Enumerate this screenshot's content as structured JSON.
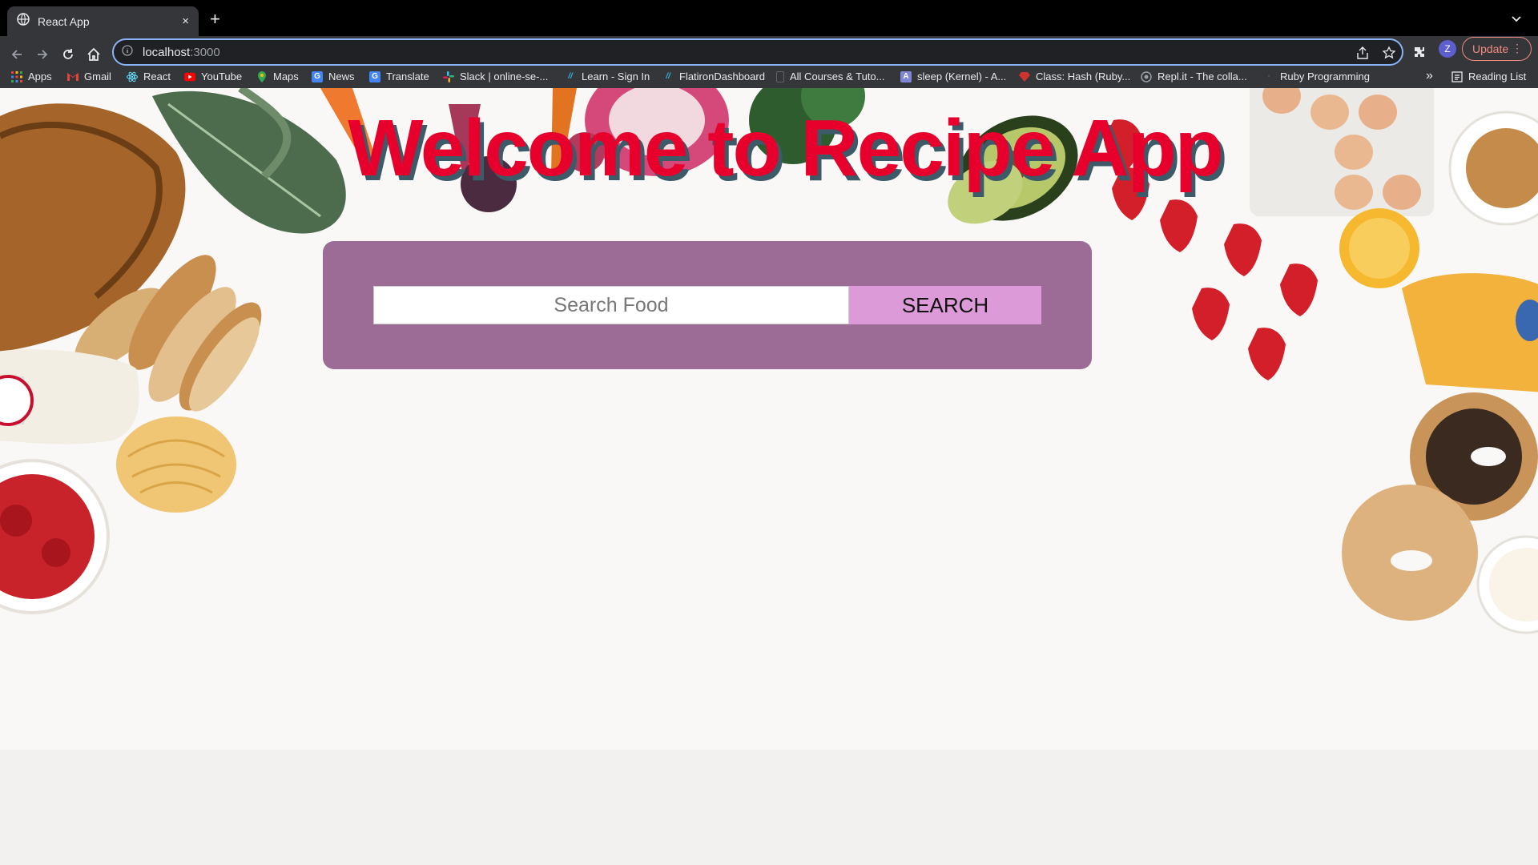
{
  "browser": {
    "tab_title": "React App",
    "tab_close": "×",
    "new_tab": "+",
    "url_host": "localhost",
    "url_path": ":3000",
    "profile_initial": "Z",
    "update_label": "Update",
    "bookmarks": [
      {
        "label": "Apps",
        "icon": "apps-grid-icon",
        "color": "#e94235"
      },
      {
        "label": "Gmail",
        "icon": "gmail-icon",
        "color": "#ea4335"
      },
      {
        "label": "React",
        "icon": "react-icon",
        "color": "#61dafb"
      },
      {
        "label": "YouTube",
        "icon": "youtube-icon",
        "color": "#ff0000"
      },
      {
        "label": "Maps",
        "icon": "maps-icon",
        "color": "#34a853"
      },
      {
        "label": "News",
        "icon": "news-icon",
        "color": "#4285f4"
      },
      {
        "label": "Translate",
        "icon": "translate-icon",
        "color": "#4285f4"
      },
      {
        "label": "Slack | online-se-...",
        "icon": "slack-icon",
        "color": "#e01e5a"
      },
      {
        "label": "Learn - Sign In",
        "icon": "flatiron-icon",
        "color": "#2fb6e3"
      },
      {
        "label": "FlatironDashboard",
        "icon": "flatiron-icon",
        "color": "#2fb6e3"
      },
      {
        "label": "All Courses & Tuto...",
        "icon": "page-icon",
        "color": "#5f6368"
      },
      {
        "label": "sleep (Kernel) - A...",
        "icon": "ruby-doc-icon",
        "color": "#7f86d6"
      },
      {
        "label": "Class: Hash (Ruby...",
        "icon": "ruby-icon",
        "color": "#cc342d"
      },
      {
        "label": "Repl.it - The colla...",
        "icon": "replit-icon",
        "color": "#9aa0a6"
      },
      {
        "label": "Ruby Programming",
        "icon": "ruby-icon",
        "color": "#5f6368"
      }
    ],
    "bookmarks_more": "»",
    "reading_list": "Reading List"
  },
  "page": {
    "title": "Welcome to Recipe App",
    "search": {
      "placeholder": "Search Food",
      "value": "",
      "button_label": "SEARCH"
    }
  },
  "colors": {
    "title": "#e6002b",
    "panel": "#9c6c97",
    "button": "#dd9ad8"
  }
}
